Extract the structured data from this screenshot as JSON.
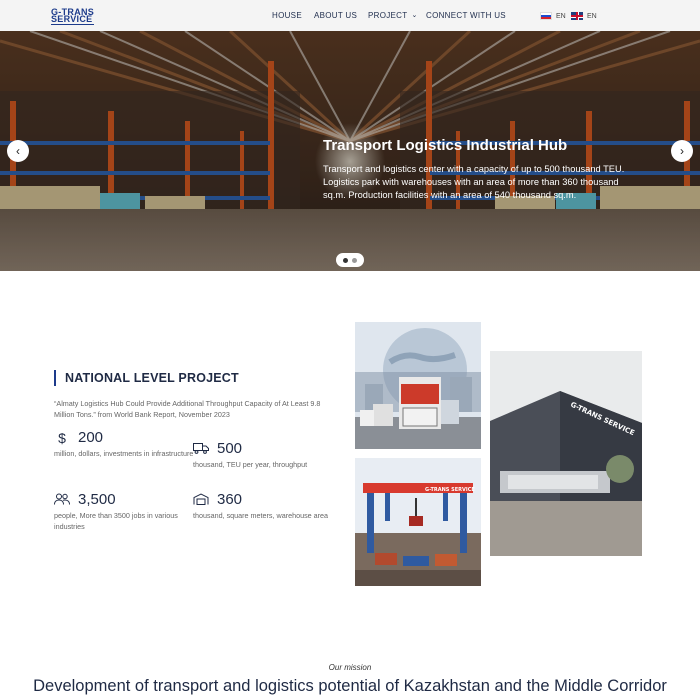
{
  "header": {
    "logo_line1": "G-TRANS",
    "logo_line2": "SERVICE",
    "nav": [
      "HOUSE",
      "ABOUT US",
      "PROJECT",
      "CONNECT WITH US"
    ],
    "lang": [
      "EN",
      "EN"
    ]
  },
  "hero": {
    "title": "Transport Logistics Industrial Hub",
    "text": "Transport and logistics center with a capacity of up to 500 thousand TEU. Logistics park with warehouses with an area of more than 360 thousand sq.m. Production facilities with an area of 540 thousand sq.m.",
    "prev_icon": "chevron-left-icon",
    "next_icon": "chevron-right-icon",
    "slides": 2,
    "active_slide": 1
  },
  "project": {
    "title": "NATIONAL LEVEL PROJECT",
    "quote": "“Almaty Logistics Hub Could Provide Additional Throughput Capacity of At Least 9.8 Million Tons.” from World Bank Report, November 2023",
    "stats": [
      {
        "icon": "dollar-icon",
        "value": "200",
        "desc": "million, dollars, investments in infrastructure"
      },
      {
        "icon": "truck-icon",
        "value": "500",
        "desc": "thousand, TEU per year, throughput"
      },
      {
        "icon": "people-icon",
        "value": "3,500",
        "desc": "people, More than 3500 jobs in various industries"
      },
      {
        "icon": "warehouse-icon",
        "value": "360",
        "desc": "thousand, square meters, warehouse area"
      }
    ]
  },
  "mission": {
    "label": "Our mission",
    "title": "Development of transport and logistics potential of Kazakhstan and the Middle Corridor"
  },
  "photos": {
    "building_sign": "G-TRANS SERVICE",
    "crane_sign": "G-TRANS SERVICE"
  }
}
